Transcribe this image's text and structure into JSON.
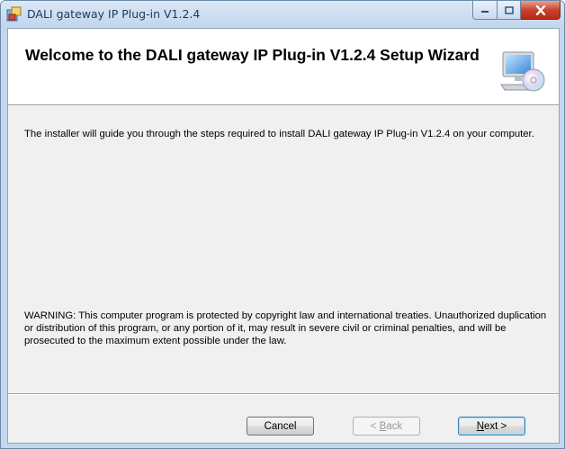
{
  "window": {
    "title": "DALI gateway IP Plug-in V1.2.4"
  },
  "header": {
    "title": "Welcome to the DALI gateway IP Plug-in V1.2.4 Setup Wizard",
    "icon": "computer-cd-icon"
  },
  "body": {
    "intro": "The installer will guide you through the steps required to install DALI gateway IP Plug-in V1.2.4 on your computer.",
    "warning": "WARNING: This computer program is protected by copyright law and international treaties. Unauthorized duplication or distribution of this program, or any portion of it, may result in severe civil or criminal penalties, and will be prosecuted to the maximum extent possible under the law."
  },
  "buttons": {
    "cancel": "Cancel",
    "back_prefix": "< ",
    "back_mnemonic": "B",
    "back_rest": "ack",
    "next_mnemonic": "N",
    "next_rest": "ext >"
  },
  "colors": {
    "client_bg": "#f0f0f0",
    "close_red": "#c7442c",
    "title_text": "#1e395b"
  }
}
